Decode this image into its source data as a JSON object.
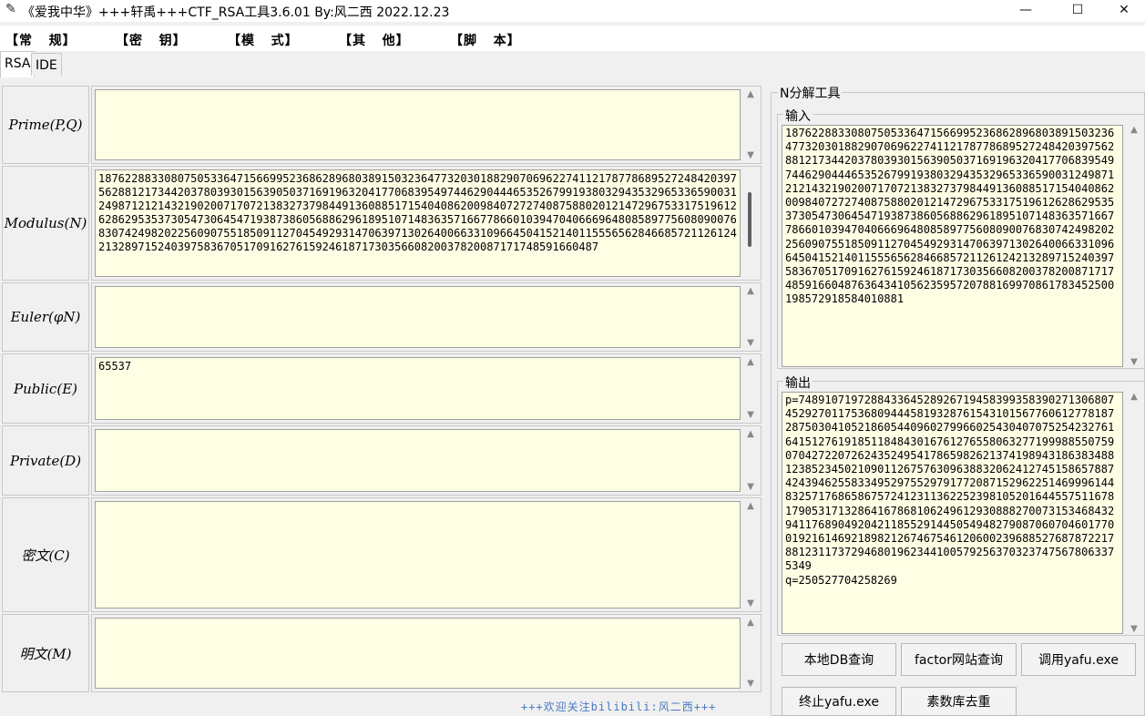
{
  "window": {
    "title": "《爱我中华》+++轩禹+++CTF_RSA工具3.6.01   By:风二西 2022.12.23",
    "minimize": "—",
    "maximize": "☐",
    "close": "✕"
  },
  "menu": [
    "【常   规】",
    "【密   钥】",
    "【模   式】",
    "【其   他】",
    "【脚   本】"
  ],
  "tabs": [
    "RSA",
    "IDE"
  ],
  "fields": {
    "prime": {
      "label": "Prime(P,Q)",
      "value": ""
    },
    "modulus": {
      "label": "Modulus(N)",
      "value": "187622883308075053364715669952368628968038915032364773203018829070696227411217877868952724842039756288121734420378039301563905037169196320417706839549744629044465352679919380329435329653365900312498712121432190200717072138327379844913608851715404086200984072727408758802012147296753317519612628629535373054730645471938738605688629618951071483635716677866010394704066696480858977560809007683074249820225609075518509112704549293147063971302640066331096645041521401155565628466857211261242132897152403975836705170916276159246187173035660820037820087171748591660487"
    },
    "euler": {
      "label": "Euler(φN)",
      "value": ""
    },
    "public": {
      "label": "Public(E)",
      "value": "65537"
    },
    "private": {
      "label": "Private(D)",
      "value": ""
    },
    "cipher": {
      "label": "密文(C)",
      "value": ""
    },
    "plain": {
      "label": "明文(M)",
      "value": ""
    }
  },
  "footer_note": "+++欢迎关注bilibili:风二西+++",
  "factor_tool": {
    "title": "N分解工具",
    "input_label": "输入",
    "input_value": "187622883308075053364715669952368628968038915032364773203018829070696227411217877868952724842039756288121734420378039301563905037169196320417706839549744629044465352679919380329435329653365900312498712121432190200717072138327379844913608851715404086200984072727408758802012147296753317519612628629535373054730645471938738605688629618951071483635716677866010394704066696480858977560809007683074249820225609075518509112704549293147063971302640066331096645041521401155565628466857211261242132897152403975836705170916276159246187173035660820037820087171748591660487636434105623595720788169970861783452500198572918584010881",
    "output_label": "输出",
    "output_value": "p=748910719728843364528926719458399358390271306807452927011753680944458193287615431015677606127781872875030410521860544096027996602543040707525423276164151276191851184843016761276558063277199988550759070427220726243524954178659826213741989431863834881238523450210901126757630963883206241274515865788742439462558334952975529791772087152962251469996144832571768658675724123113622523981052016445575116781790531713286416786810624961293088827007315346843294117689049204211855291445054948279087060704601770019216146921898212674675461206002396885276878722178812311737294680196234410057925637032374756780633753­49\nq=250527704258269",
    "buttons": [
      "本地DB查询",
      "factor网站查询",
      "调用yafu.exe",
      "终止yafu.exe",
      "素数库去重"
    ]
  }
}
